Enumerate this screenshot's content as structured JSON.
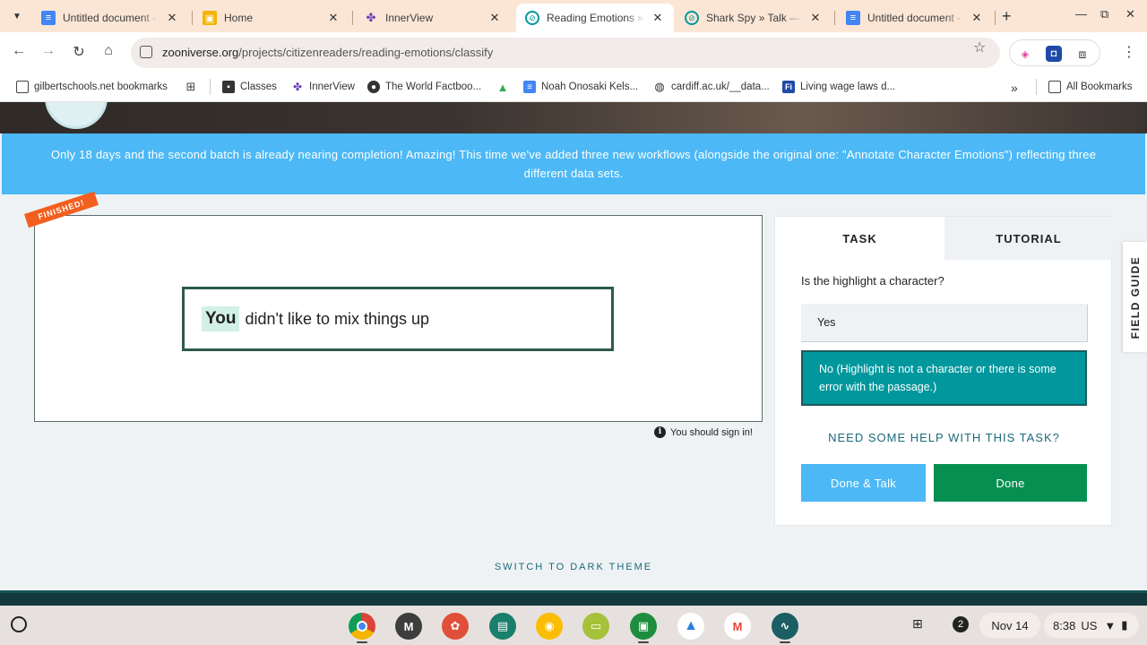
{
  "browser": {
    "tabs": [
      {
        "title": "Untitled document - G",
        "favicon": "google-docs-icon",
        "color": "#4285f4",
        "active": false
      },
      {
        "title": "Home",
        "favicon": "google-classroom-icon",
        "color": "#f4b400",
        "active": false
      },
      {
        "title": "InnerView",
        "favicon": "innerview-icon",
        "color": "#6a3fb5",
        "active": false
      },
      {
        "title": "Reading Emotions » C",
        "favicon": "zooniverse-icon",
        "color": "#00979d",
        "active": true
      },
      {
        "title": "Shark Spy » Talk — Zo",
        "favicon": "zooniverse-icon",
        "color": "#00979d",
        "active": false
      },
      {
        "title": "Untitled document - G",
        "favicon": "google-docs-icon",
        "color": "#4285f4",
        "active": false
      }
    ],
    "url_host": "zooniverse.org",
    "url_path": "/projects/citizenreaders/reading-emotions/classify",
    "bookmarks": [
      {
        "label": "gilbertschools.net bookmarks",
        "icon": "folder-icon"
      },
      {
        "label": "Classes",
        "icon": "classes-icon"
      },
      {
        "label": "InnerView",
        "icon": "innerview-icon"
      },
      {
        "label": "The World Factboo...",
        "icon": "cia-icon"
      },
      {
        "label": "Noah Onosaki Kels...",
        "icon": "google-docs-icon"
      },
      {
        "label": "cardiff.ac.uk/__data...",
        "icon": "globe-icon"
      },
      {
        "label": "Living wage laws d...",
        "icon": "fi-icon"
      }
    ],
    "all_bookmarks": "All Bookmarks"
  },
  "page": {
    "announcement": "Only 18 days and the second batch is already nearing completion! Amazing! This time we've added three new workflows (alongside the original one: \"Annotate Character Emotions\") reflecting three different data sets.",
    "ribbon": "FINISHED!",
    "passage_highlight": "You",
    "passage_rest": "didn't like to mix things up",
    "signin_note": "You should sign in!",
    "tabs": {
      "task": "TASK",
      "tutorial": "TUTORIAL"
    },
    "question": "Is the highlight a character?",
    "answers": {
      "yes": "Yes",
      "no": "No (Highlight is not a character or there is some error with the passage.)"
    },
    "help_link": "NEED SOME HELP WITH THIS TASK?",
    "buttons": {
      "done_talk": "Done & Talk",
      "done": "Done"
    },
    "field_guide": "FIELD GUIDE",
    "theme_toggle": "SWITCH TO DARK THEME",
    "colors": {
      "accent_teal": "#00979d",
      "announce_blue": "#4cb8f5",
      "done_green": "#078f52",
      "ribbon_orange": "#f35f1f"
    }
  },
  "shelf": {
    "apps": [
      {
        "name": "chrome-icon",
        "letter": "",
        "color": "#db4437"
      },
      {
        "name": "m-app-icon",
        "letter": "M",
        "color": "#3d3d3d"
      },
      {
        "name": "canvas-icon",
        "letter": "",
        "color": "#e04f39"
      },
      {
        "name": "classroom-app-icon",
        "letter": "",
        "color": "#1a7f6b"
      },
      {
        "name": "keep-icon",
        "letter": "",
        "color": "#fbbc04"
      },
      {
        "name": "slides-icon",
        "letter": "",
        "color": "#a6c13a"
      },
      {
        "name": "google-classroom-icon",
        "letter": "",
        "color": "#1e8e3e"
      },
      {
        "name": "google-drive-icon",
        "letter": "",
        "color": "#2a7de1"
      },
      {
        "name": "gmail-icon",
        "letter": "M",
        "color": "#ea4335"
      },
      {
        "name": "app-icon",
        "letter": "",
        "color": "#1b5e63"
      }
    ],
    "notification_count": "2",
    "date": "Nov 14",
    "time": "8:38",
    "locale": "US"
  }
}
